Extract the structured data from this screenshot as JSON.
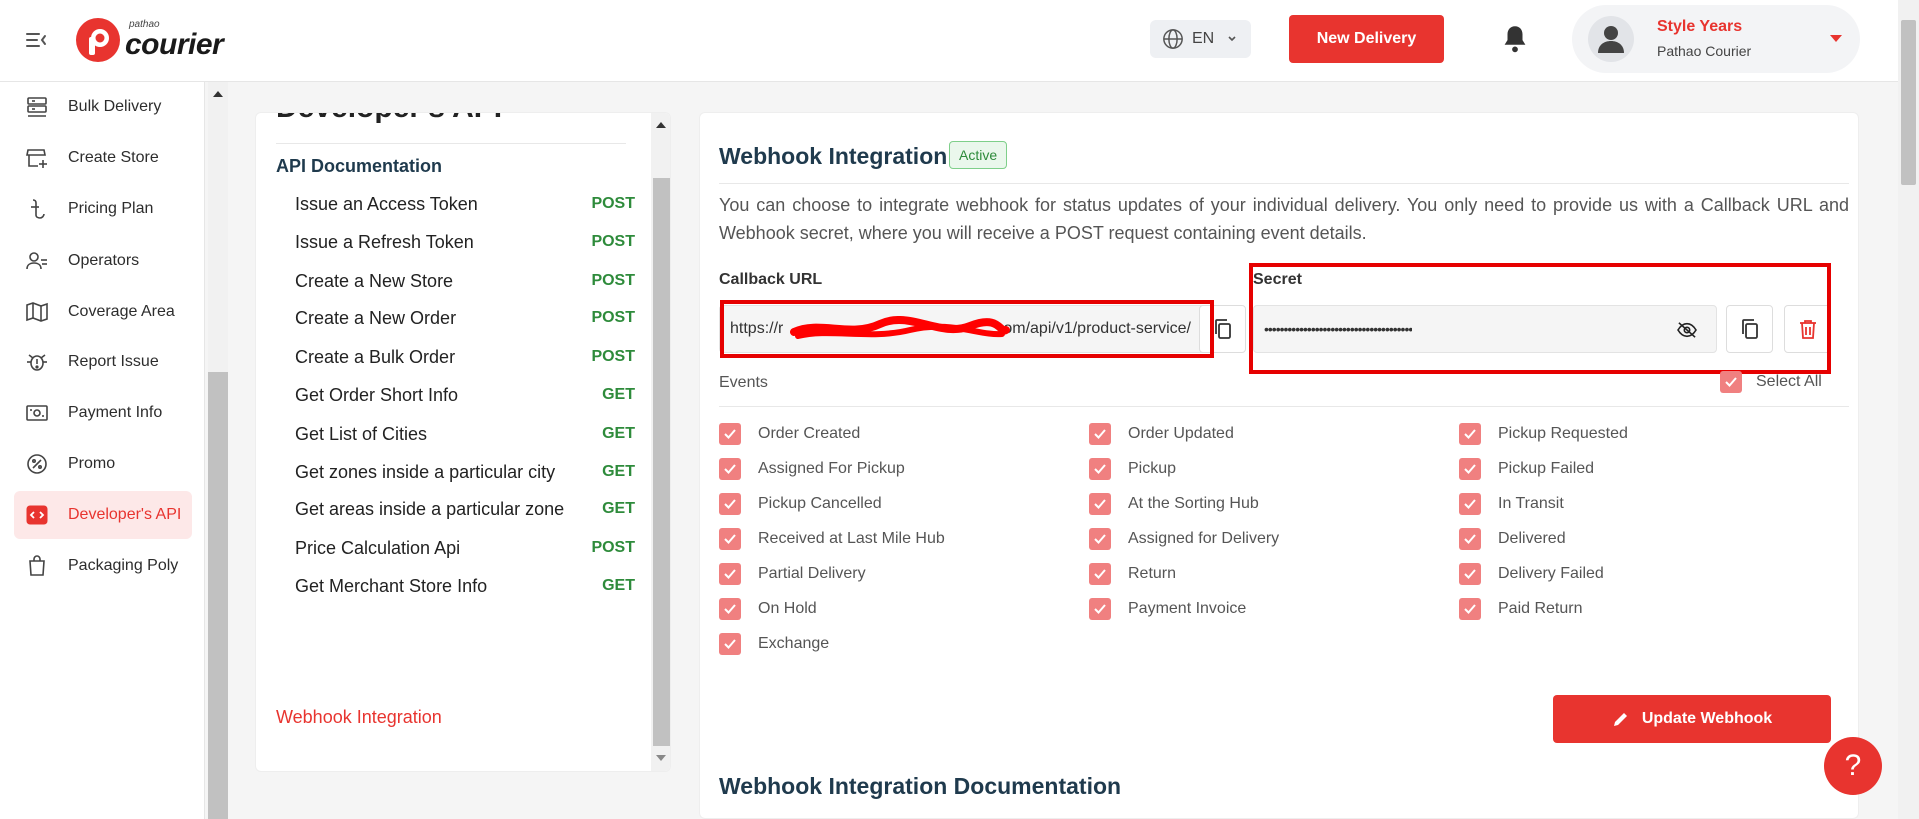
{
  "header": {
    "logo_small": "pathao",
    "logo_big": "courier",
    "language": "EN",
    "new_delivery": "New Delivery",
    "user_name": "Style Years",
    "user_company": "Pathao Courier"
  },
  "sidebar": {
    "items": [
      {
        "label": "Bulk Delivery",
        "icon": "bulk-delivery-icon"
      },
      {
        "label": "Create Store",
        "icon": "store-icon"
      },
      {
        "label": "Pricing Plan",
        "icon": "taka-icon"
      },
      {
        "label": "Operators",
        "icon": "operators-icon"
      },
      {
        "label": "Coverage Area",
        "icon": "map-icon"
      },
      {
        "label": "Report Issue",
        "icon": "bug-icon"
      },
      {
        "label": "Payment Info",
        "icon": "payment-icon"
      },
      {
        "label": "Promo",
        "icon": "promo-icon"
      },
      {
        "label": "Developer's API",
        "icon": "code-icon",
        "active": true
      },
      {
        "label": "Packaging Poly",
        "icon": "bag-icon"
      }
    ]
  },
  "docs": {
    "heading": "Developer's API",
    "subheading": "API Documentation",
    "items": [
      {
        "name": "Issue an Access Token",
        "method": "POST"
      },
      {
        "name": "Issue a Refresh Token",
        "method": "POST"
      },
      {
        "name": "Create a New Store",
        "method": "POST"
      },
      {
        "name": "Create a New Order",
        "method": "POST"
      },
      {
        "name": "Create a Bulk Order",
        "method": "POST"
      },
      {
        "name": "Get Order Short Info",
        "method": "GET"
      },
      {
        "name": "Get List of Cities",
        "method": "GET"
      },
      {
        "name": "Get zones inside a particular city",
        "method": "GET"
      },
      {
        "name": "Get areas inside a particular zone",
        "method": "GET"
      },
      {
        "name": "Price Calculation Api",
        "method": "POST"
      },
      {
        "name": "Get Merchant Store Info",
        "method": "GET"
      }
    ],
    "webhook_link": "Webhook Integration"
  },
  "webhook": {
    "title": "Webhook Integration",
    "status": "Active",
    "description": "You can choose to integrate webhook for status updates of your individual delivery. You only need to provide us with a Callback URL and Webhook secret, where you will receive a POST request containing event details.",
    "callback_label": "Callback URL",
    "callback_prefix": "https://r",
    "callback_suffix": "om/api/v1/product-service/",
    "secret_label": "Secret",
    "secret_value": "••••••••••••••••••••••••••••••••••••••",
    "events_label": "Events",
    "select_all": "Select All",
    "events": [
      [
        "Order Created",
        "Assigned For Pickup",
        "Pickup Cancelled",
        "Received at Last Mile Hub",
        "Partial Delivery",
        "On Hold",
        "Exchange"
      ],
      [
        "Order Updated",
        "Pickup",
        "At the Sorting Hub",
        "Assigned for Delivery",
        "Return",
        "Payment Invoice"
      ],
      [
        "Pickup Requested",
        "Pickup Failed",
        "In Transit",
        "Delivered",
        "Delivery Failed",
        "Paid Return"
      ]
    ],
    "update_button": "Update Webhook",
    "doc_title": "Webhook Integration Documentation"
  },
  "help": "?",
  "colors": {
    "brand_red": "#e8342f",
    "check_pink": "#f08080",
    "success_green": "#2e8b3b"
  }
}
